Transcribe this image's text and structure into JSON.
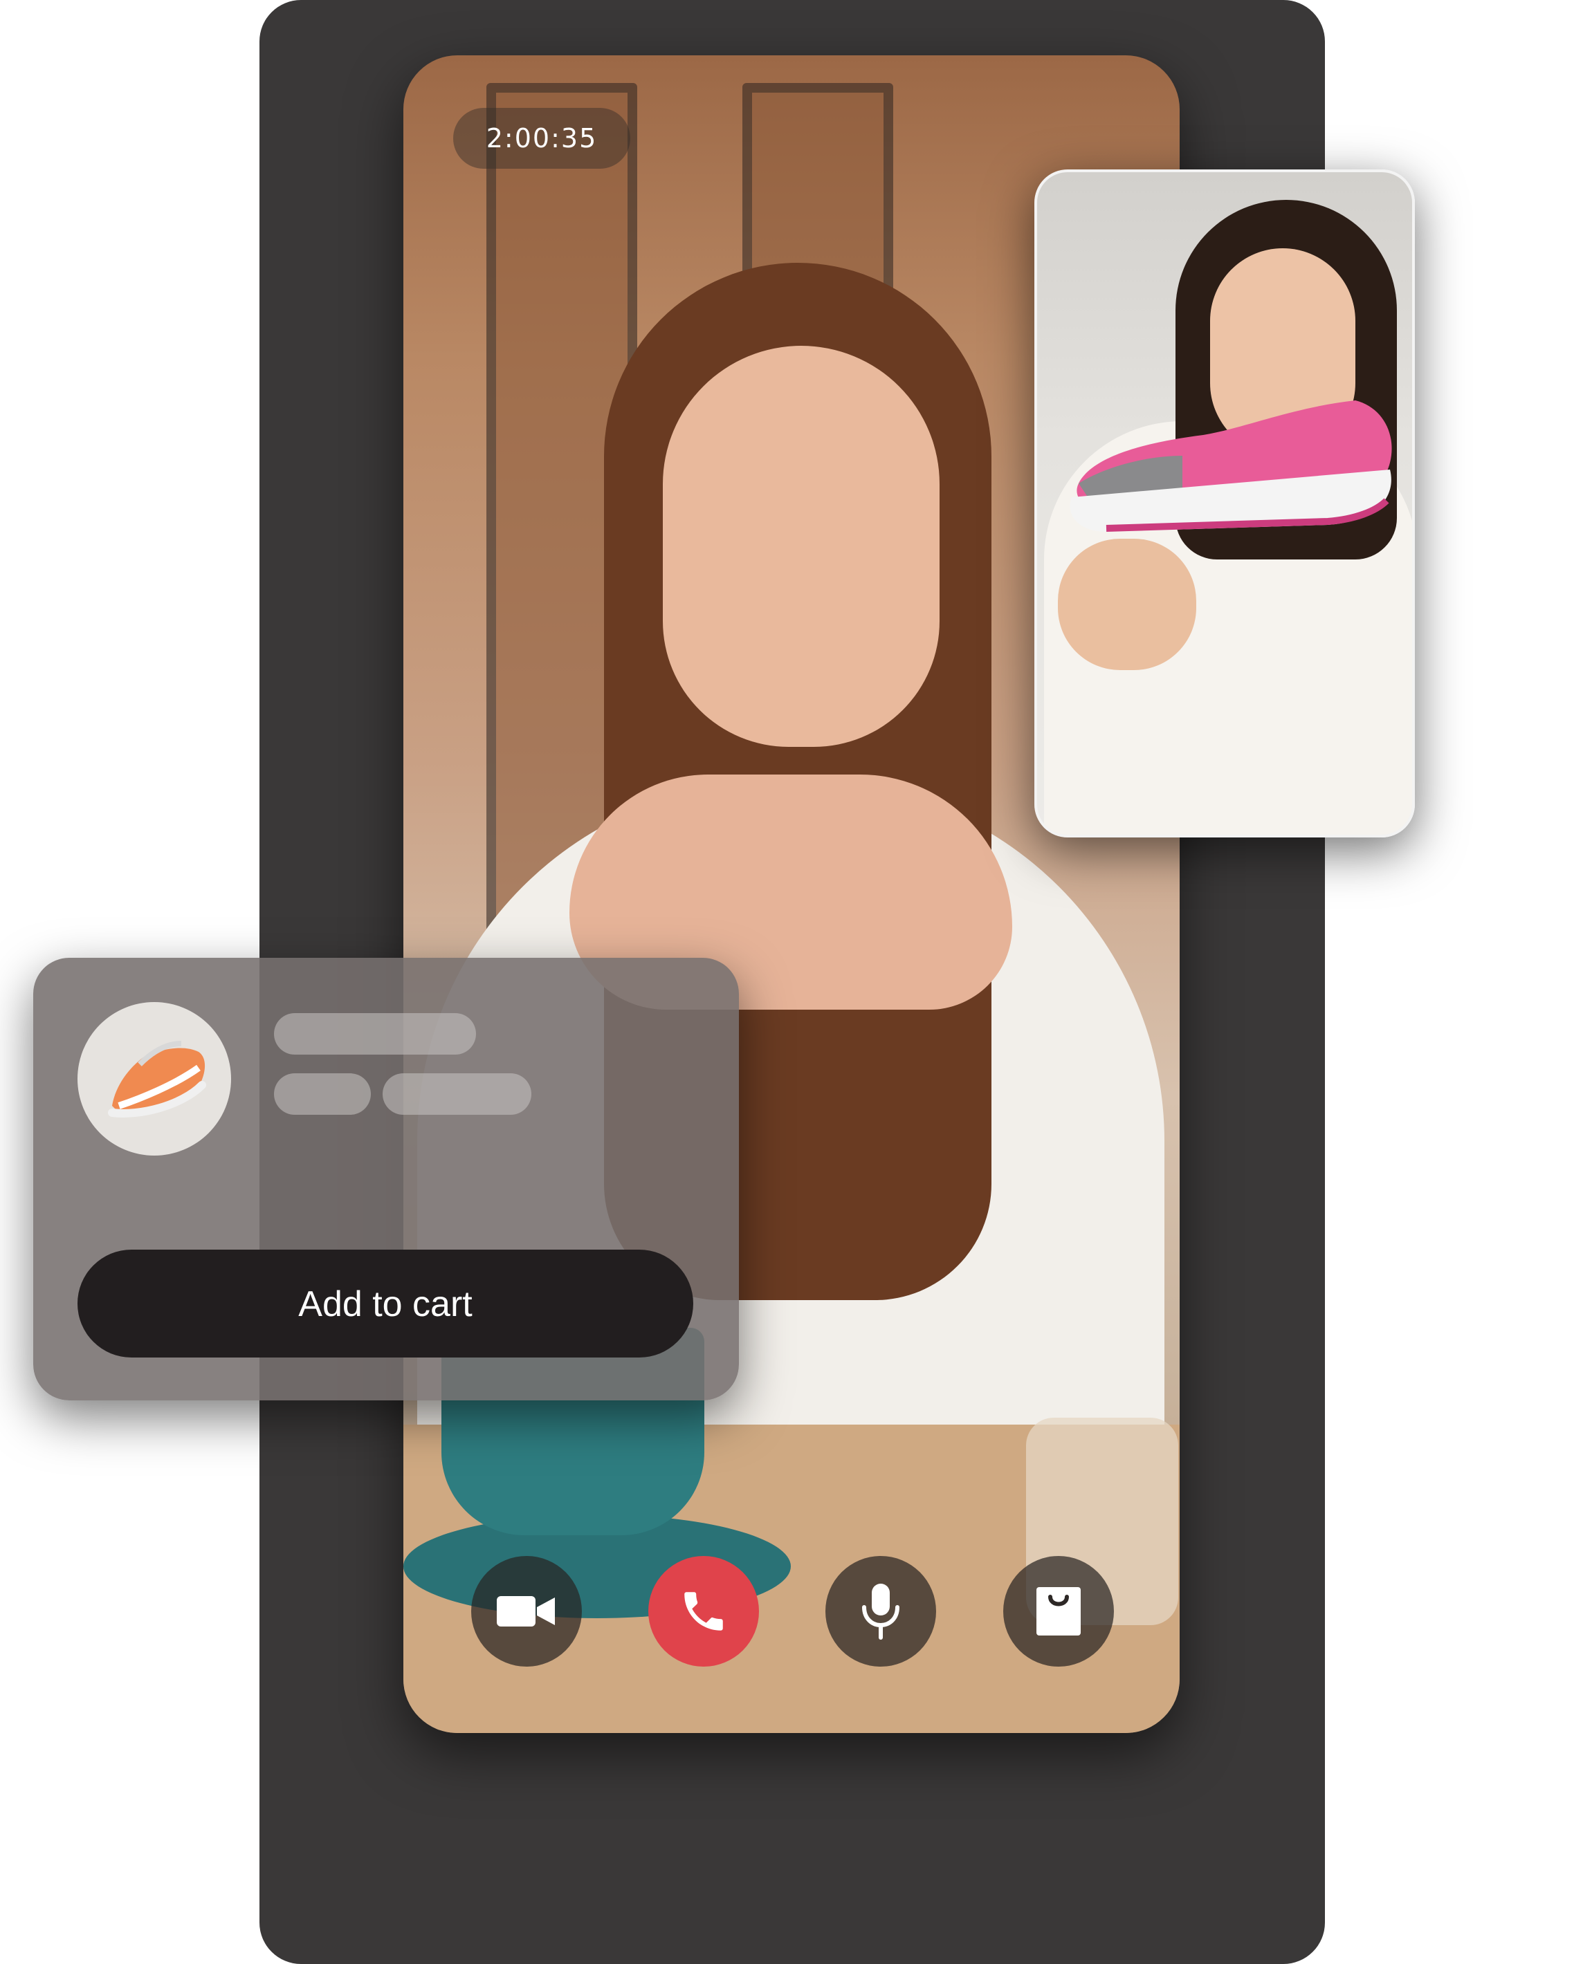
{
  "call": {
    "timer": "2:00:35"
  },
  "controls": [
    {
      "icon": "video-camera-icon"
    },
    {
      "icon": "phone-hangup-icon",
      "color": "#e0434b"
    },
    {
      "icon": "microphone-icon"
    },
    {
      "icon": "shopping-bag-icon"
    }
  ],
  "product_card": {
    "thumbnail_icon": "sneaker-thumbnail",
    "button_label": "Add to cart"
  },
  "colors": {
    "hangup": "#e0434b",
    "button_bg": "#221e1f",
    "backdrop": "#3a3838"
  }
}
